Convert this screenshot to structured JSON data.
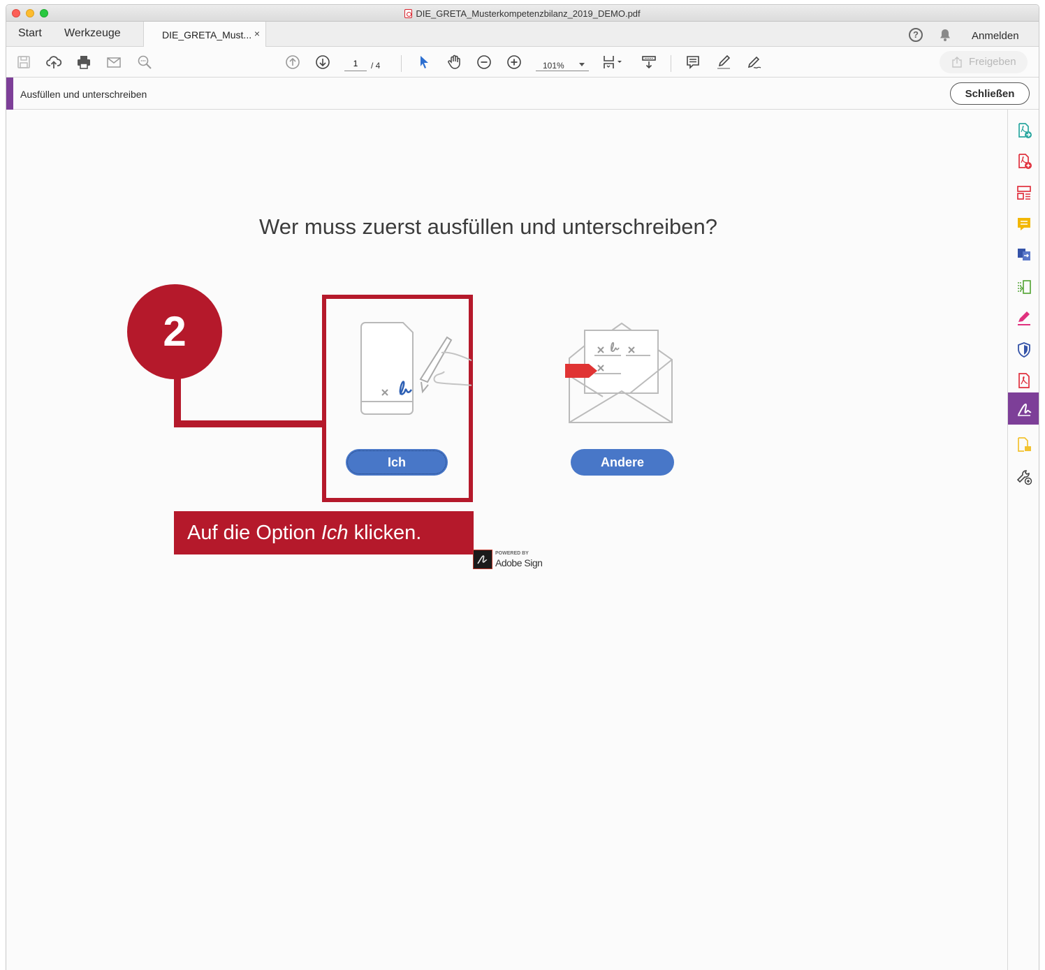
{
  "window": {
    "title": "DIE_GRETA_Musterkompetenzbilanz_2019_DEMO.pdf"
  },
  "tabs": {
    "start": "Start",
    "tools": "Werkzeuge",
    "document": "DIE_GRETA_Must...",
    "close": "×"
  },
  "header": {
    "help": "?",
    "login": "Anmelden"
  },
  "toolbar": {
    "page_current": "1",
    "page_total": "/ 4",
    "zoom": "101%",
    "share": "Freigeben"
  },
  "fill_sign": {
    "title": "Ausfüllen und unterschreiben",
    "close": "Schließen"
  },
  "dialog": {
    "question": "Wer muss zuerst ausfüllen und unterschreiben?",
    "option_me": "Ich",
    "option_others": "Andere"
  },
  "annotation": {
    "step": "2",
    "text_before": "Auf die Option ",
    "text_em": "Ich",
    "text_after": " klicken."
  },
  "powered_by": {
    "label": "POWERED BY",
    "brand": "Adobe Sign"
  },
  "colors": {
    "accent_red": "#b5192b",
    "button_blue": "#4877c8",
    "tool_purple": "#7d3f98"
  },
  "icons": {
    "toolbar": [
      "save-icon",
      "upload-cloud-icon",
      "print-icon",
      "mail-icon",
      "search-zoom-icon",
      "page-up-icon",
      "page-down-icon",
      "select-cursor-icon",
      "hand-icon",
      "zoom-out-icon",
      "zoom-in-icon",
      "page-view-icon",
      "scroll-mode-icon",
      "comment-icon",
      "highlight-pen-icon",
      "sign-icon"
    ],
    "right_column": [
      "export-pdf-icon",
      "create-pdf-icon",
      "organize-pages-icon",
      "comment-icon",
      "combine-files-icon",
      "edit-pdf-icon",
      "fill-sign-icon",
      "protect-icon",
      "pdf-icon",
      "adobe-sign-icon",
      "send-review-icon",
      "more-tools-icon"
    ]
  }
}
